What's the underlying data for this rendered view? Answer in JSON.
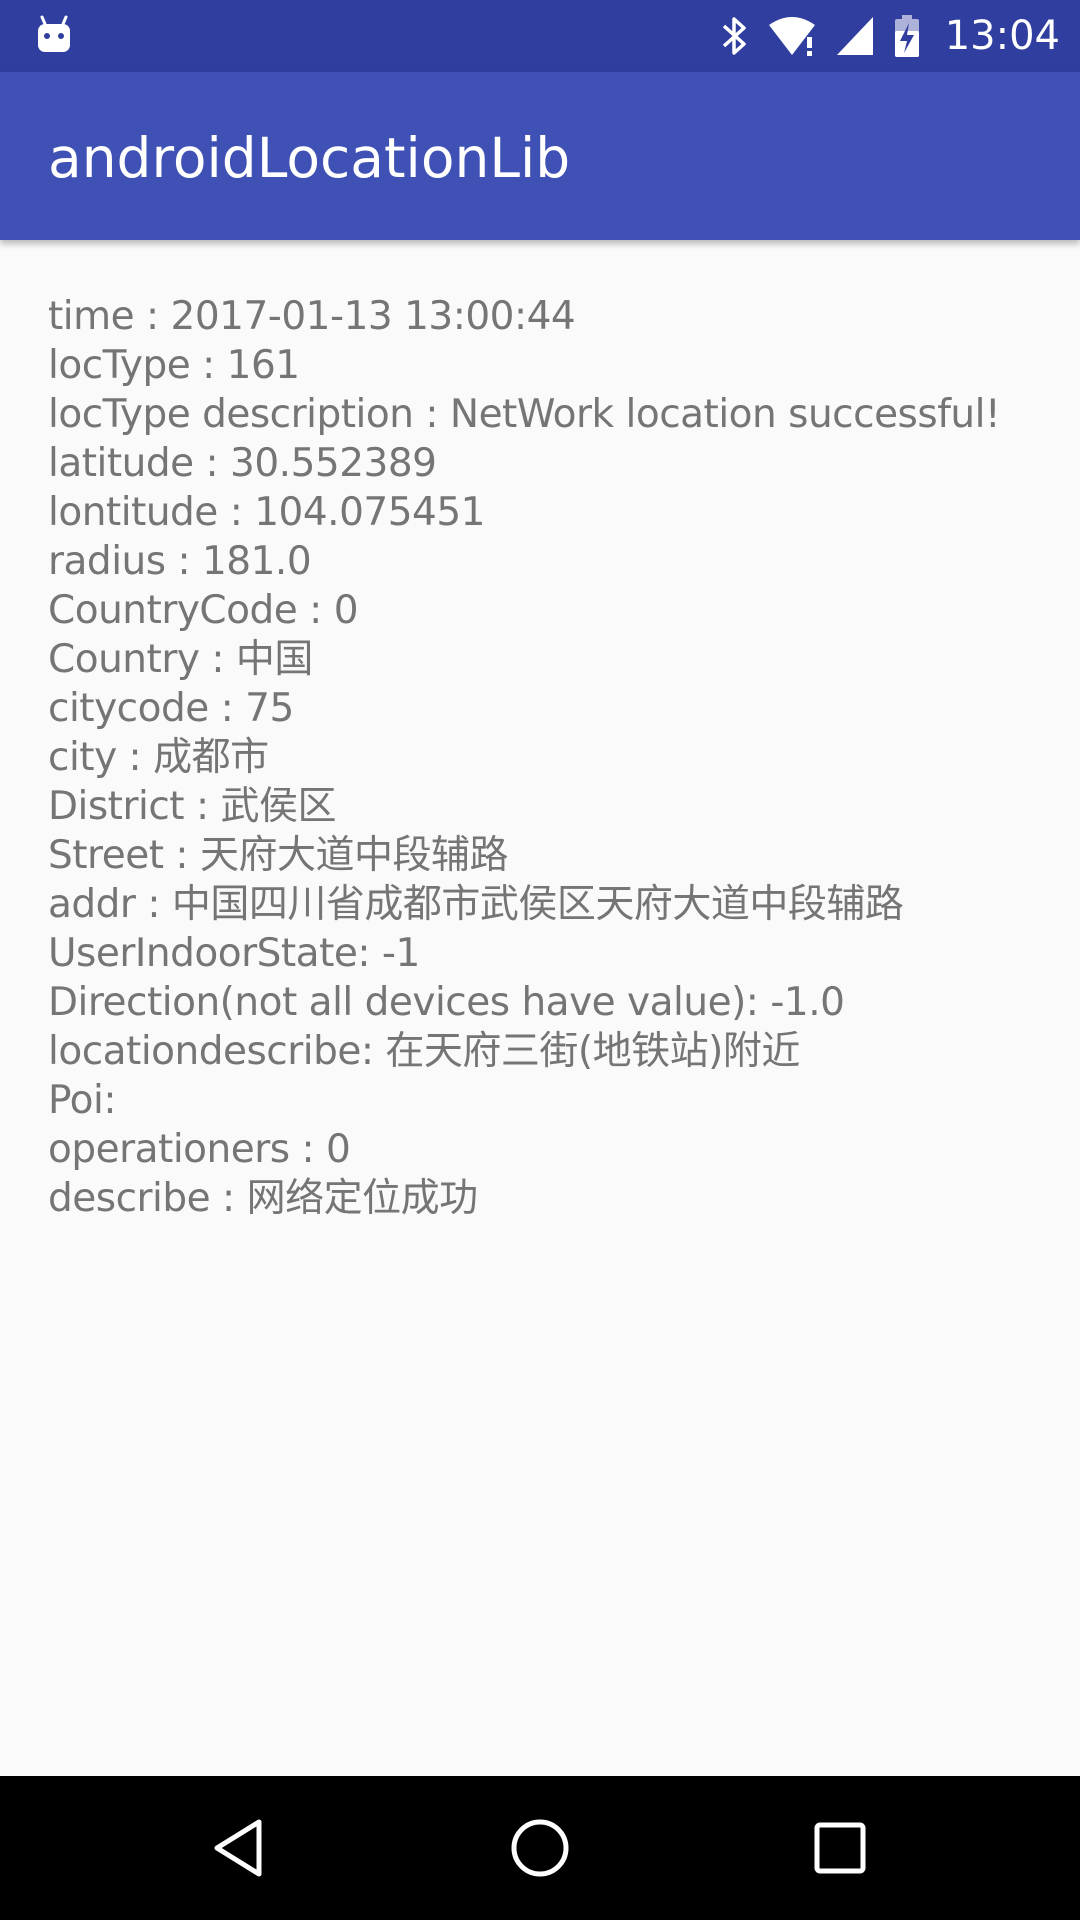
{
  "status_bar": {
    "time": "13:04",
    "icons": [
      "android-notification-icon",
      "bluetooth-icon",
      "wifi-icon",
      "cellular-signal-icon",
      "battery-charging-icon"
    ]
  },
  "app_bar": {
    "title": "androidLocationLib"
  },
  "location_info": {
    "lines": [
      "time : 2017-01-13 13:00:44",
      "locType : 161",
      "locType description : NetWork location successful!",
      "latitude : 30.552389",
      "lontitude : 104.075451",
      "radius : 181.0",
      "CountryCode : 0",
      "Country : 中国",
      "citycode : 75",
      "city : 成都市",
      "District : 武侯区",
      "Street : 天府大道中段辅路",
      "addr : 中国四川省成都市武侯区天府大道中段辅路",
      "UserIndoorState: -1",
      "Direction(not all devices have value): -1.0",
      "locationdescribe: 在天府三街(地铁站)附近",
      "Poi:",
      "operationers : 0",
      "describe : 网络定位成功"
    ]
  },
  "nav_bar": {
    "buttons": [
      "back-icon",
      "home-icon",
      "recents-icon"
    ]
  },
  "colors": {
    "status_bar": "#303f9f",
    "app_bar": "#3f51b5",
    "background": "#fafafa",
    "text": "#757575",
    "nav_bar": "#000000"
  }
}
